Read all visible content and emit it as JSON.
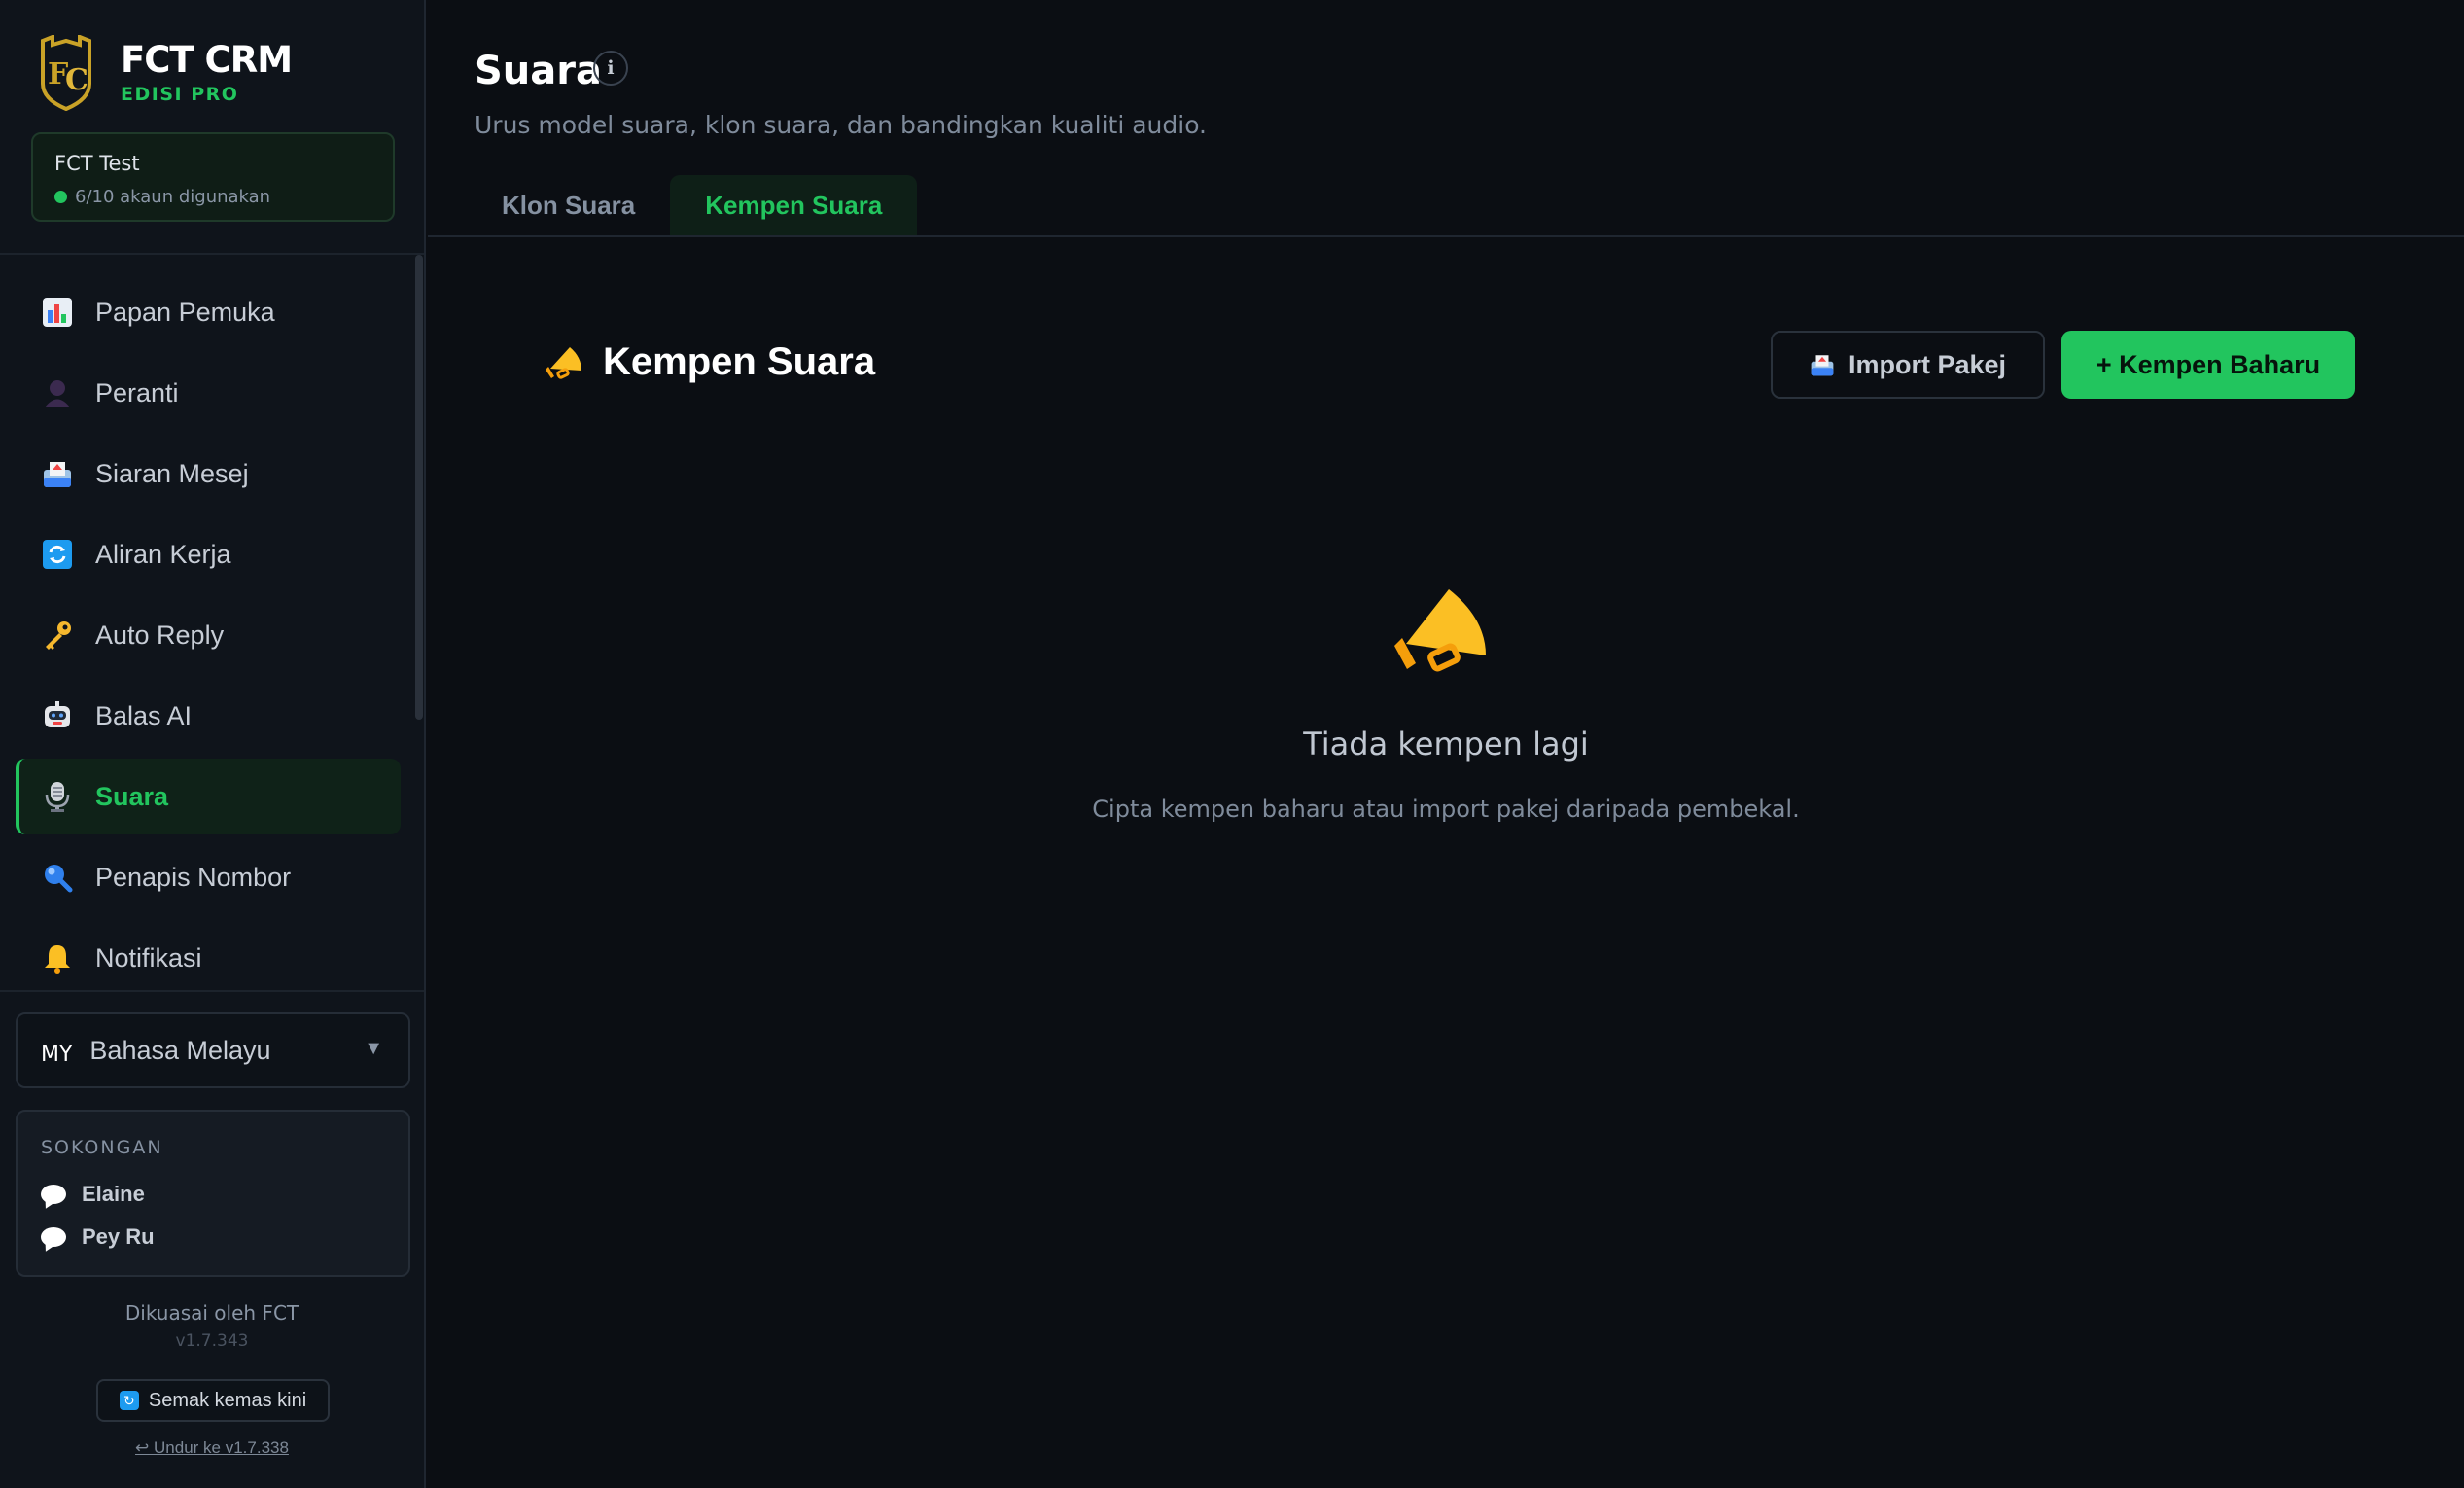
{
  "brand": {
    "name": "FCT CRM",
    "edition": "EDISI PRO"
  },
  "account": {
    "name": "FCT Test",
    "usage": "6/10 akaun digunakan"
  },
  "sidebar": {
    "items": [
      {
        "label": "Papan Pemuka",
        "icon": "chart-icon"
      },
      {
        "label": "Peranti",
        "icon": "user-icon"
      },
      {
        "label": "Siaran Mesej",
        "icon": "outbox-icon"
      },
      {
        "label": "Aliran Kerja",
        "icon": "refresh-icon"
      },
      {
        "label": "Auto Reply",
        "icon": "key-icon"
      },
      {
        "label": "Balas AI",
        "icon": "robot-icon"
      },
      {
        "label": "Suara",
        "icon": "microphone-icon",
        "active": true
      },
      {
        "label": "Penapis Nombor",
        "icon": "magnifier-icon"
      },
      {
        "label": "Notifikasi",
        "icon": "bell-icon"
      }
    ]
  },
  "language": {
    "code": "MY",
    "name": "Bahasa Melayu"
  },
  "support": {
    "title": "SOKONGAN",
    "contacts": [
      "Elaine",
      "Pey Ru"
    ]
  },
  "footer": {
    "powered": "Dikuasai oleh FCT",
    "version": "v1.7.343",
    "check_update": "Semak kemas kini",
    "downgrade": "↩ Undur ke v1.7.338"
  },
  "page": {
    "title": "Suara",
    "subtitle": "Urus model suara, klon suara, dan bandingkan kualiti audio.",
    "tabs": [
      {
        "label": "Klon Suara"
      },
      {
        "label": "Kempen Suara",
        "active": true
      }
    ]
  },
  "section": {
    "title": "Kempen Suara",
    "import_label": "Import Pakej",
    "new_label": "+ Kempen Baharu"
  },
  "empty": {
    "title": "Tiada kempen lagi",
    "subtitle": "Cipta kempen baharu atau import pakej daripada pembekal."
  },
  "colors": {
    "accent": "#22c55e",
    "background": "#0b0e13",
    "sidebar": "#0f141b"
  }
}
